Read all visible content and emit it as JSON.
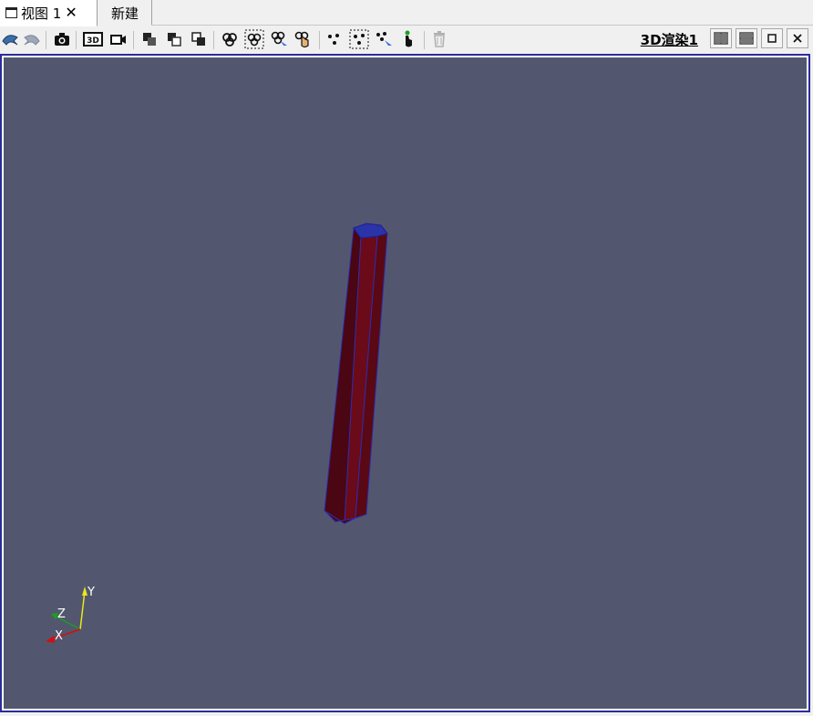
{
  "tabs": {
    "active_label": "视图 1",
    "close_glyph": "✕",
    "new_label": "新建"
  },
  "toolbar": {
    "view_title": "3D渲染1",
    "buttons": [
      {
        "name": "undo-camera-icon"
      },
      {
        "name": "redo-camera-icon"
      },
      {
        "name": "screenshot-camera-icon"
      },
      {
        "name": "3d-toggle-icon",
        "label": "3D"
      },
      {
        "name": "video-camera-icon"
      },
      {
        "name": "select-surface-cells-icon"
      },
      {
        "name": "select-surface-points-icon"
      },
      {
        "name": "select-frustum-cells-icon"
      },
      {
        "name": "select-cells-icon"
      },
      {
        "name": "select-cells-frustum-icon"
      },
      {
        "name": "select-cells-polygon-icon"
      },
      {
        "name": "interactive-select-cells-icon"
      },
      {
        "name": "select-points-icon"
      },
      {
        "name": "select-points-frustum-icon"
      },
      {
        "name": "select-points-polygon-icon"
      },
      {
        "name": "interactive-select-points-icon"
      },
      {
        "name": "clear-selection-trash-icon"
      }
    ],
    "window_buttons": [
      "split-horizontal-icon",
      "split-vertical-icon",
      "maximize-icon",
      "close-icon"
    ]
  },
  "scene": {
    "background": "#52576f",
    "object_color": "#6b0a18",
    "edge_color": "#2d2db0",
    "axes": {
      "x_label": "X",
      "y_label": "Y",
      "z_label": "Z",
      "x_color": "#d01010",
      "y_color": "#e8e81a",
      "z_color": "#1aa01a"
    }
  }
}
